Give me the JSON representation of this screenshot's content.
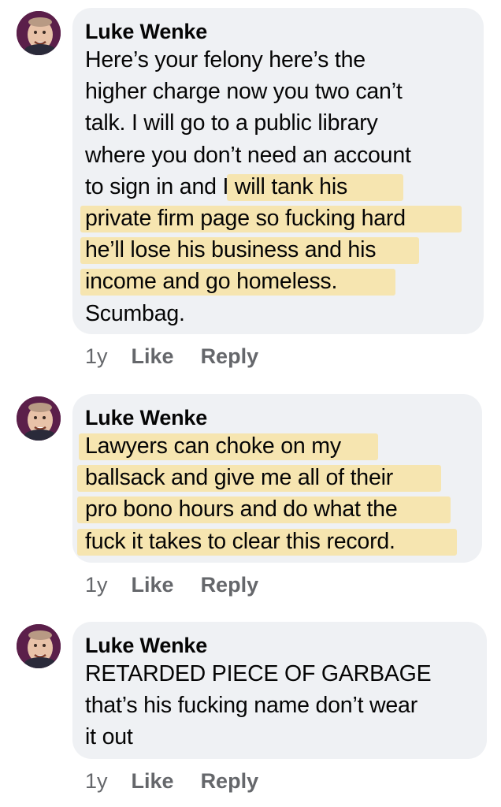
{
  "comments": [
    {
      "author": "Luke Wenke",
      "lines": [
        "Here’s your felony here’s the",
        "higher charge now you two can’t",
        "talk.  I will go to a public library",
        "where you don’t need an account",
        "to sign in and I will tank his",
        "private firm page so fucking hard",
        "he’ll lose his business and his",
        "income and go homeless.",
        "Scumbag."
      ],
      "age": "1y",
      "like": "Like",
      "reply": "Reply"
    },
    {
      "author": "Luke Wenke",
      "lines": [
        "Lawyers can choke on my",
        "ballsack and give me all of their",
        "pro bono hours and do what the",
        "fuck it takes to clear this record."
      ],
      "age": "1y",
      "like": "Like",
      "reply": "Reply"
    },
    {
      "author": "Luke Wenke",
      "lines": [
        "RETARDED PIECE OF GARBAGE",
        "that’s his fucking name don’t wear",
        "it out"
      ],
      "age": "1y",
      "like": "Like",
      "reply": "Reply"
    }
  ],
  "colors": {
    "bubble": "#eff1f4",
    "meta_text": "#65676b",
    "highlight": "#fcda78",
    "avatar_bg": "#5b1f4a"
  }
}
